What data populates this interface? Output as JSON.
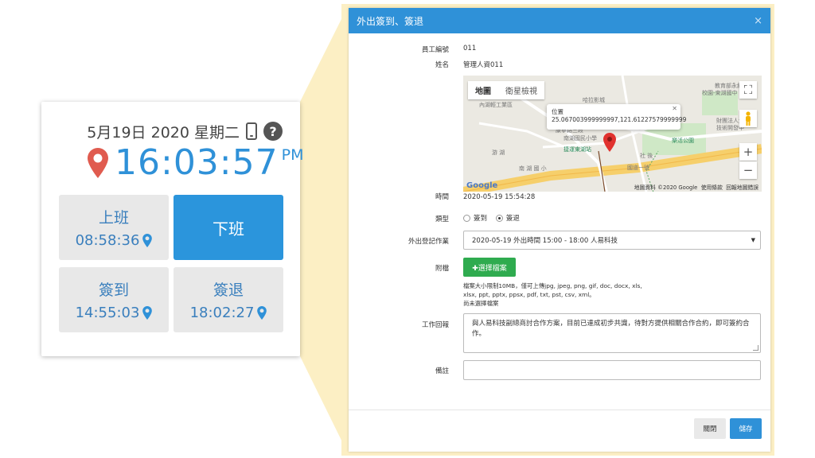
{
  "clock_card": {
    "date": "5月19日 2020 星期二",
    "time": "16:03:57",
    "ampm": "PM",
    "tiles": [
      {
        "label": "上班",
        "time": "08:58:36"
      },
      {
        "label": "下班",
        "time": ""
      },
      {
        "label": "簽到",
        "time": "14:55:03"
      },
      {
        "label": "簽退",
        "time": "18:02:27"
      }
    ],
    "accent_color": "#2f91d8",
    "pin_color": "#e05b4f"
  },
  "modal": {
    "title": "外出簽到、簽退",
    "close_symbol": "×",
    "fields": {
      "employee_no_label": "員工編號",
      "employee_no": "011",
      "name_label": "姓名",
      "name": "管理人資011",
      "time_label": "時間",
      "time": "2020-05-19 15:54:28",
      "type_label": "類型",
      "type_options": [
        "簽到",
        "簽退"
      ],
      "type_selected": "簽退",
      "register_label": "外出登記作業",
      "register_value": "2020-05-19 外出時間 15:00 - 18:00 人易科技",
      "attach_label": "附檔",
      "choose_file": "✚選擇檔案",
      "file_help": "檔案大小限制10MB，僅可上傳jpg, jpeg, png, gif, doc, docx, xls, xlsx, ppt, pptx, ppsx, pdf, txt, pst, csv, xml。",
      "no_file": "尚未選擇檔案",
      "report_label": "工作回報",
      "report_text": "與人易科技副總商討合作方案，目前已達成初步共識，待對方提供相關合作合約，即可簽約合作。",
      "note_label": "備註",
      "note_value": ""
    },
    "map": {
      "tab_map": "地圖",
      "tab_satellite": "衛星檢視",
      "info_title": "位置",
      "info_coords": "25.067003999999997,121.61227579999999",
      "labels": [
        "哈拉影城",
        "教育部永續",
        "校園-東湖國中",
        "內湖輕工業區",
        "南湖國民小學",
        "捷運東湖站",
        "財團法人生",
        "技術開發中",
        "樂活公園",
        "康寧路三段",
        "國道一號",
        "社 後",
        "游 湖",
        "南 湖 國 小"
      ],
      "attribution": "地圖資料 ©2020 Google",
      "terms": "使用條款",
      "report": "回報地圖錯誤",
      "google": "Google"
    },
    "footer": {
      "close_label": "關閉",
      "save_label": "儲存"
    },
    "header_color": "#2f91d8",
    "frame_color": "#fcefc4"
  }
}
